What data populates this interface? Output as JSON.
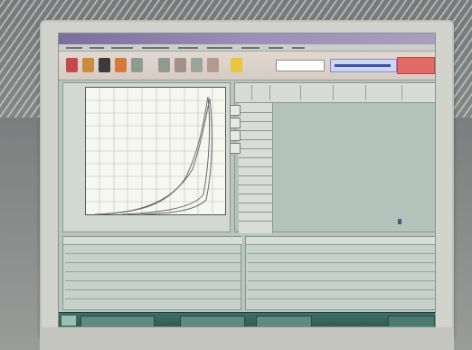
{
  "window": {
    "title": ""
  },
  "menu_items": [
    "",
    "",
    "",
    "",
    "",
    "",
    "",
    "",
    ""
  ],
  "toolbar": {
    "combo_value": "",
    "brand_text": "",
    "badge_text": ""
  },
  "graph": {
    "title": "",
    "x_label": "",
    "y_label": ""
  },
  "grid": {
    "title": "",
    "columns": [
      "",
      "",
      "",
      "",
      "",
      "",
      ""
    ]
  },
  "bottom_left_panel": {
    "title": ""
  },
  "bottom_right_panel": {
    "title": ""
  },
  "taskbar": {
    "items": [
      "",
      "",
      ""
    ],
    "clock": ""
  },
  "colors": {
    "title_bar": "#8a7fb0",
    "grid_bg": "#b3c3bc",
    "taskbar": "#35625b",
    "badge": "#e06a66"
  }
}
